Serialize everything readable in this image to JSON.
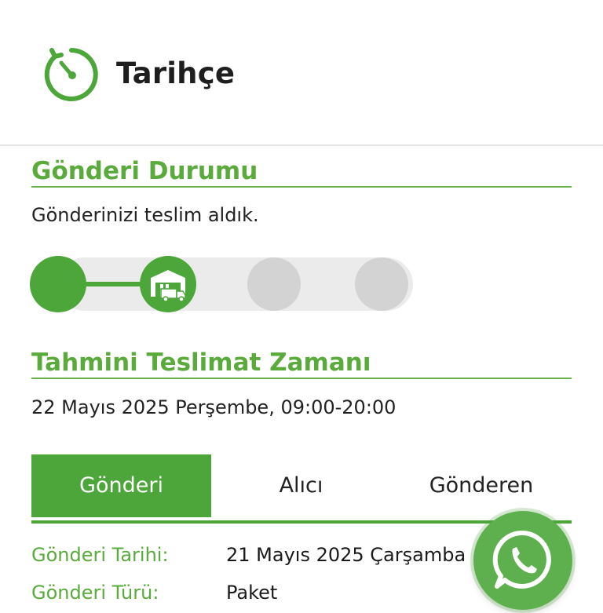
{
  "header": {
    "title": "Tarihçe",
    "icon": "history-timer-icon"
  },
  "status": {
    "title": "Gönderi Durumu",
    "text": "Gönderinizi teslim aldık.",
    "progress": {
      "total_steps": 4,
      "completed_steps": 2,
      "current_step_icon": "warehouse-truck-icon"
    }
  },
  "eta": {
    "title": "Tahmini Teslimat Zamanı",
    "text": "22 Mayıs 2025 Perşembe, 09:00-20:00"
  },
  "tabs": [
    {
      "label": "Gönderi",
      "active": true
    },
    {
      "label": "Alıcı",
      "active": false
    },
    {
      "label": "Gönderen",
      "active": false
    }
  ],
  "details": [
    {
      "label": "Gönderi Tarihi:",
      "value": "21 Mayıs 2025 Çarşamba"
    },
    {
      "label": "Gönderi Türü:",
      "value": "Paket"
    }
  ],
  "whatsapp": {
    "icon": "whatsapp-icon"
  },
  "colors": {
    "accent": "#4ca63a",
    "accent_text": "#5aab3c",
    "inactive_step": "#d3d3d3",
    "track": "#ebebeb"
  }
}
